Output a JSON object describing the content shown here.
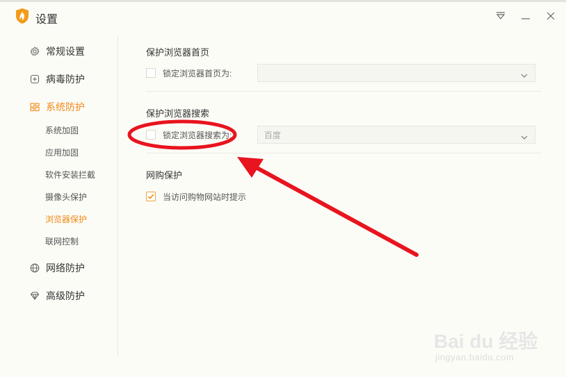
{
  "window": {
    "title": "设置"
  },
  "sidebar": {
    "items": [
      {
        "label": "常规设置",
        "icon": "gear-icon"
      },
      {
        "label": "病毒防护",
        "icon": "plus-square-icon"
      },
      {
        "label": "系统防护",
        "icon": "system-icon",
        "active": true
      },
      {
        "label": "网络防护",
        "icon": "globe-icon"
      },
      {
        "label": "高级防护",
        "icon": "diamond-icon"
      }
    ],
    "subitems": [
      {
        "label": "系统加固"
      },
      {
        "label": "应用加固"
      },
      {
        "label": "软件安装拦截"
      },
      {
        "label": "摄像头保护"
      },
      {
        "label": "浏览器保护",
        "active": true
      },
      {
        "label": "联网控制"
      }
    ]
  },
  "main": {
    "homepage_section": {
      "title": "保护浏览器首页",
      "checkbox_label": "锁定浏览器首页为:",
      "checked": false,
      "select_value": ""
    },
    "search_section": {
      "title": "保护浏览器搜索",
      "checkbox_label": "锁定浏览器搜索为:",
      "checked": false,
      "select_value": "百度"
    },
    "shopping_section": {
      "title": "网购保护",
      "checkbox_label": "当访问购物网站时提示",
      "checked": true
    }
  },
  "watermark": {
    "logo": "Bai du 经验",
    "url": "jingyan.baidu.com"
  },
  "colors": {
    "accent": "#f08a19",
    "annotation": "#e8141e",
    "background": "#fcfcf7"
  }
}
